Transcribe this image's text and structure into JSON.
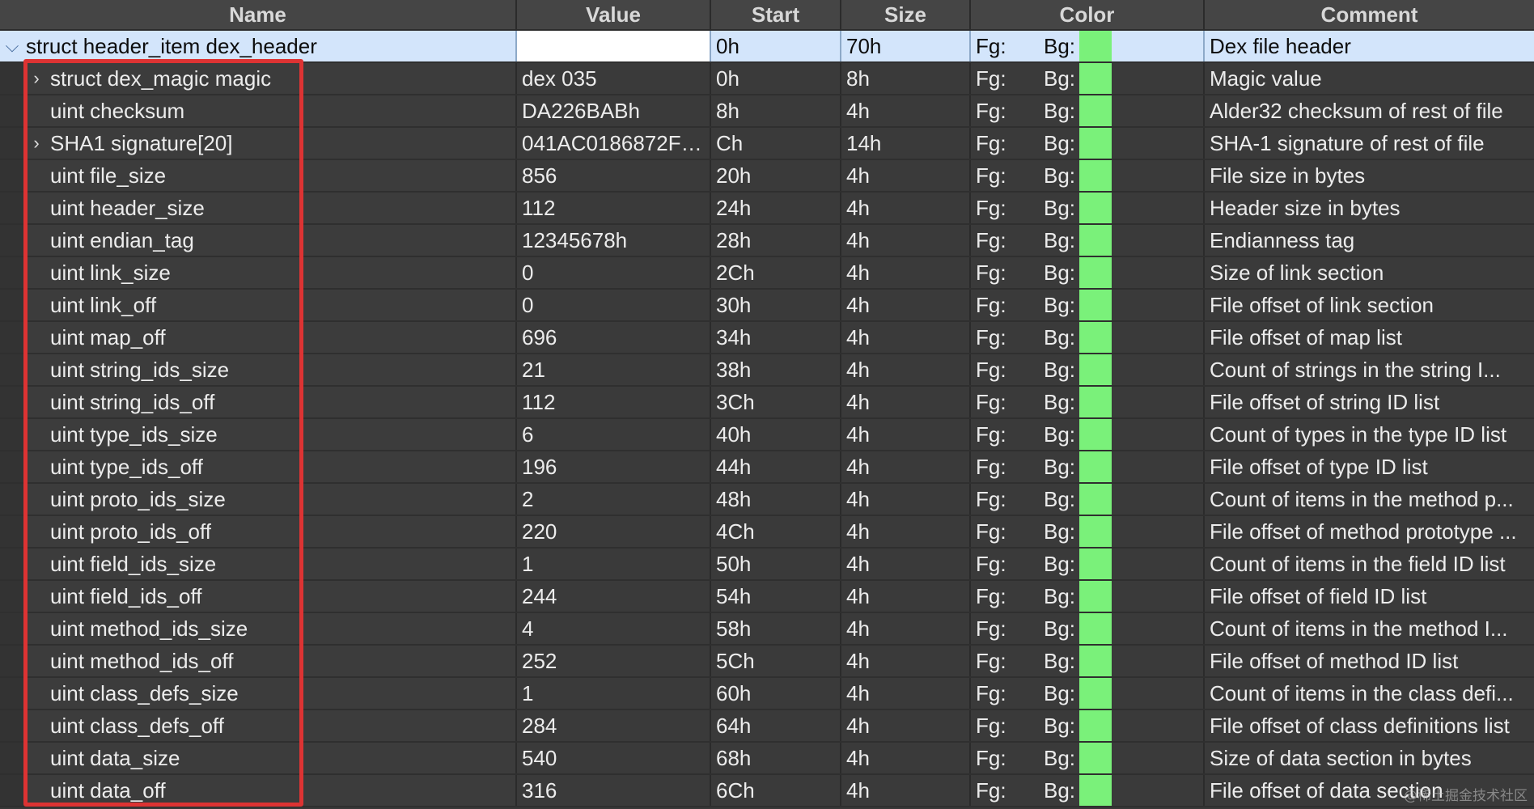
{
  "columns": {
    "name": "Name",
    "value": "Value",
    "start": "Start",
    "size": "Size",
    "color": "Color",
    "comment": "Comment"
  },
  "color_labels": {
    "fg": "Fg:",
    "bg": "Bg:"
  },
  "colors": {
    "bg_swatch": "#7af17a",
    "selection": "#d3e5fb",
    "highlight_box": "#dd3333"
  },
  "root_row": {
    "name": "struct header_item dex_header",
    "value": "",
    "start": "0h",
    "size": "70h",
    "comment": "Dex file header",
    "expanded": true
  },
  "rows": [
    {
      "name": "struct dex_magic magic",
      "value": "dex 035",
      "start": "0h",
      "size": "8h",
      "comment": "Magic value",
      "expandable": true
    },
    {
      "name": "uint checksum",
      "value": "DA226BABh",
      "start": "8h",
      "size": "4h",
      "comment": "Alder32 checksum of rest of file",
      "expandable": false
    },
    {
      "name": "SHA1 signature[20]",
      "value": "041AC0186872F1...",
      "start": "Ch",
      "size": "14h",
      "comment": "SHA-1 signature of rest of file",
      "expandable": true
    },
    {
      "name": "uint file_size",
      "value": "856",
      "start": "20h",
      "size": "4h",
      "comment": "File size in bytes",
      "expandable": false
    },
    {
      "name": "uint header_size",
      "value": "112",
      "start": "24h",
      "size": "4h",
      "comment": "Header size in bytes",
      "expandable": false
    },
    {
      "name": "uint endian_tag",
      "value": "12345678h",
      "start": "28h",
      "size": "4h",
      "comment": "Endianness tag",
      "expandable": false
    },
    {
      "name": "uint link_size",
      "value": "0",
      "start": "2Ch",
      "size": "4h",
      "comment": "Size of link section",
      "expandable": false
    },
    {
      "name": "uint link_off",
      "value": "0",
      "start": "30h",
      "size": "4h",
      "comment": "File offset of link section",
      "expandable": false
    },
    {
      "name": "uint map_off",
      "value": "696",
      "start": "34h",
      "size": "4h",
      "comment": "File offset of map list",
      "expandable": false
    },
    {
      "name": "uint string_ids_size",
      "value": "21",
      "start": "38h",
      "size": "4h",
      "comment": "Count of strings in the string I...",
      "expandable": false
    },
    {
      "name": "uint string_ids_off",
      "value": "112",
      "start": "3Ch",
      "size": "4h",
      "comment": "File offset of string ID list",
      "expandable": false
    },
    {
      "name": "uint type_ids_size",
      "value": "6",
      "start": "40h",
      "size": "4h",
      "comment": "Count of types in the type ID list",
      "expandable": false
    },
    {
      "name": "uint type_ids_off",
      "value": "196",
      "start": "44h",
      "size": "4h",
      "comment": "File offset of type ID list",
      "expandable": false
    },
    {
      "name": "uint proto_ids_size",
      "value": "2",
      "start": "48h",
      "size": "4h",
      "comment": "Count of items in the method p...",
      "expandable": false
    },
    {
      "name": "uint proto_ids_off",
      "value": "220",
      "start": "4Ch",
      "size": "4h",
      "comment": "File offset of method prototype ...",
      "expandable": false
    },
    {
      "name": "uint field_ids_size",
      "value": "1",
      "start": "50h",
      "size": "4h",
      "comment": "Count of items in the field ID list",
      "expandable": false
    },
    {
      "name": "uint field_ids_off",
      "value": "244",
      "start": "54h",
      "size": "4h",
      "comment": "File offset of field ID list",
      "expandable": false
    },
    {
      "name": "uint method_ids_size",
      "value": "4",
      "start": "58h",
      "size": "4h",
      "comment": "Count of items in the method I...",
      "expandable": false
    },
    {
      "name": "uint method_ids_off",
      "value": "252",
      "start": "5Ch",
      "size": "4h",
      "comment": "File offset of method ID list",
      "expandable": false
    },
    {
      "name": "uint class_defs_size",
      "value": "1",
      "start": "60h",
      "size": "4h",
      "comment": "Count of items in the class defi...",
      "expandable": false
    },
    {
      "name": "uint class_defs_off",
      "value": "284",
      "start": "64h",
      "size": "4h",
      "comment": "File offset of class definitions list",
      "expandable": false
    },
    {
      "name": "uint data_size",
      "value": "540",
      "start": "68h",
      "size": "4h",
      "comment": "Size of data section in bytes",
      "expandable": false
    },
    {
      "name": "uint data_off",
      "value": "316",
      "start": "6Ch",
      "size": "4h",
      "comment": "File offset of data section",
      "expandable": false
    }
  ],
  "icons": {
    "expanded": "chevron-down-icon",
    "collapsed": "chevron-right-icon"
  },
  "watermark": "@稀土掘金技术社区"
}
